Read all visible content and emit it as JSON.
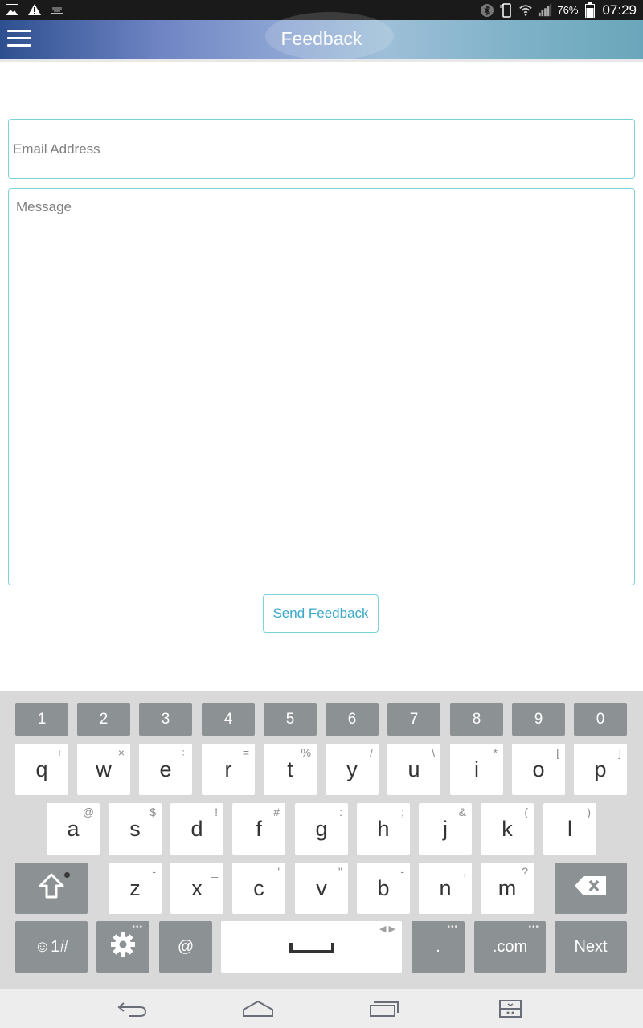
{
  "status_bar": {
    "battery_percent": "76%",
    "time": "07:29"
  },
  "app_bar": {
    "title": "Feedback",
    "menu_icon": "hamburger-menu-icon"
  },
  "form": {
    "email_placeholder": "Email Address",
    "email_value": "",
    "message_placeholder": "Message",
    "message_value": "",
    "send_label": "Send Feedback"
  },
  "keyboard": {
    "number_row": [
      "1",
      "2",
      "3",
      "4",
      "5",
      "6",
      "7",
      "8",
      "9",
      "0"
    ],
    "row1": [
      {
        "key": "q",
        "sub": "+"
      },
      {
        "key": "w",
        "sub": "×"
      },
      {
        "key": "e",
        "sub": "÷"
      },
      {
        "key": "r",
        "sub": "="
      },
      {
        "key": "t",
        "sub": "%"
      },
      {
        "key": "y",
        "sub": "/"
      },
      {
        "key": "u",
        "sub": "\\"
      },
      {
        "key": "i",
        "sub": "*"
      },
      {
        "key": "o",
        "sub": "["
      },
      {
        "key": "p",
        "sub": "]"
      }
    ],
    "row2": [
      {
        "key": "a",
        "sub": "@"
      },
      {
        "key": "s",
        "sub": "$"
      },
      {
        "key": "d",
        "sub": "!"
      },
      {
        "key": "f",
        "sub": "#"
      },
      {
        "key": "g",
        "sub": ":"
      },
      {
        "key": "h",
        "sub": ";"
      },
      {
        "key": "j",
        "sub": "&"
      },
      {
        "key": "k",
        "sub": "("
      },
      {
        "key": "l",
        "sub": ")"
      }
    ],
    "row3": [
      {
        "key": "z",
        "sub": "-"
      },
      {
        "key": "x",
        "sub": "_"
      },
      {
        "key": "c",
        "sub": "'"
      },
      {
        "key": "v",
        "sub": "\""
      },
      {
        "key": "b",
        "sub": "-"
      },
      {
        "key": "n",
        "sub": ","
      },
      {
        "key": "m",
        "sub": "?"
      }
    ],
    "symbols_label": "☺1#",
    "at_label": "@",
    "period_label": ".",
    "dotcom_label": ".com",
    "next_label": "Next"
  },
  "colors": {
    "accent": "#3aa8c9",
    "field_border": "#7ad3dd",
    "key_dark": "#8c9193"
  }
}
